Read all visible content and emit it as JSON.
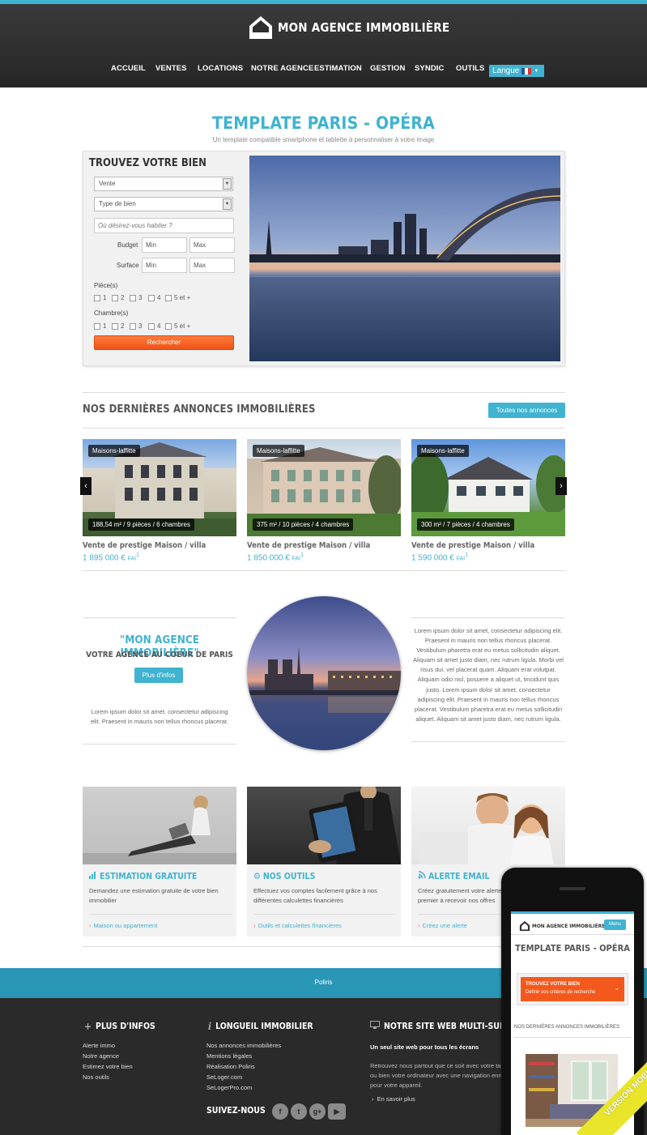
{
  "header": {
    "logo_text": "MON AGENCE IMMOBILIÈRE",
    "nav": [
      "ACCUEIL",
      "VENTES",
      "LOCATIONS",
      "NOTRE AGENCE",
      "ESTIMATION",
      "GESTION",
      "SYNDIC",
      "OUTILS"
    ],
    "language_label": "Langue",
    "language_icon": "french-flag-icon"
  },
  "hero": {
    "title": "TEMPLATE PARIS - OPÉRA",
    "subtitle": "Un template compatible smartphone et tablette à personnaliser à votre image"
  },
  "search": {
    "title": "TROUVEZ VOTRE BIEN",
    "transaction_value": "Vente",
    "type_placeholder": "Type de bien",
    "location_placeholder": "Où désirez-vous habiter ?",
    "budget_label": "Budget",
    "surface_label": "Surface",
    "min_placeholder": "Min",
    "max_placeholder": "Max",
    "rooms_label": "Pièce(s)",
    "bedrooms_label": "Chambre(s)",
    "count_options": [
      "1",
      "2",
      "3",
      "4",
      "5 et +"
    ],
    "submit_label": "Rechercher"
  },
  "listings": {
    "section_title": "NOS DERNIÈRES ANNONCES IMMOBILIÈRES",
    "all_button": "Toutes nos annonces",
    "items": [
      {
        "city": "Maisons-laffitte",
        "meta": "188,54 m² / 9 pièces / 6 chambres",
        "title": "Vente de prestige Maison / villa",
        "price": "1 895 000 €",
        "fai": "FAI",
        "note": "1"
      },
      {
        "city": "Maisons-laffitte",
        "meta": "375 m² / 10 pièces / 4 chambres",
        "title": "Vente de prestige Maison / villa",
        "price": "1 850 000 €",
        "fai": "FAI",
        "note": "1"
      },
      {
        "city": "Maisons-laffitte",
        "meta": "300 m² / 7 pièces / 4 chambres",
        "title": "Vente de prestige Maison / villa",
        "price": "1 590 000 €",
        "fai": "FAI",
        "note": "1"
      }
    ]
  },
  "about": {
    "title": "\"MON AGENCE IMMOBILIÈRE\"",
    "subtitle": "VOTRE AGENCE AU COEUR DE PARIS",
    "button": "Plus d'infos",
    "left_text": "Lorem ipsum dolor sit amet, consectetur adipiscing elit. Praesent in mauris non tellus rhoncus placerat.",
    "right_text": "Lorem ipsum dolor sit amet, consectetur adipiscing elit. Praesent in mauris non tellus rhoncus placerat. Vestibulum pharetra erat eu metus sollicitudin aliquet. Aliquam sit amet justo diam, nec rutrum ligula. Morbi vel risus dui, vel placerat quam. Aliquam erat volutpat. Aliquam odio nisl, posuere a aliquet ut, tincidunt quis justo. Lorem ipsum dolor sit amet, consectetur adipiscing elit. Praesent in mauris non tellus rhoncus placerat. Vestibulum pharetra erat eu metus sollicitudin aliquet. Aliquam sit amet justo diam, nec rutrum ligula."
  },
  "features": [
    {
      "icon": "bar-chart-icon",
      "title": "ESTIMATION GRATUITE",
      "text": "Demandez une estimation gratuite de votre bien immobilier",
      "link": "Maison ou appartement"
    },
    {
      "icon": "gear-icon",
      "title": "NOS OUTILS",
      "text": "Effectuez vos comptes facilement grâce à nos différentes calculettes financières",
      "link": "Outils et calculettes financières"
    },
    {
      "icon": "rss-icon",
      "title": "ALERTE EMAIL",
      "text": "Créez gratuitement votre alerte email et soyez le premier à recevoir nos offres",
      "link": "Créez une alerte"
    }
  ],
  "band": {
    "text": "Poliris"
  },
  "footer": {
    "col1": {
      "icon": "plus-icon",
      "title": "PLUS D'INFOS",
      "links": [
        "Alerte immo",
        "Notre agence",
        "Estimez votre bien",
        "Nos outils"
      ]
    },
    "col2": {
      "icon": "info-icon",
      "title": "LONGUEIL IMMOBILIER",
      "links": [
        "Nos annonces immobilières",
        "Mentions légales",
        "Réalisation Poliris",
        "SeLoger.com",
        "SeLogerPro.com"
      ],
      "follow": "SUIVEZ-NOUS",
      "social": [
        "f",
        "t",
        "g+",
        "▶"
      ]
    },
    "col3": {
      "icon": "monitor-icon",
      "title": "NOTRE SITE WEB MULTI-SUPPORTS",
      "bold": "Un seul site web pour tous les écrans",
      "text": "Retrouvez nous partout que ce soit avec votre tablette ou bien votre ordinateur avec une navigation enrichie pour votre appareil.",
      "link": "En savoir plus"
    }
  },
  "mobile": {
    "logo_text": "MON AGENCE IMMOBILIÈRE",
    "menu": "Menu",
    "title": "TEMPLATE PARIS - OPÉRA",
    "search_title": "TROUVEZ VOTRE BIEN",
    "search_sub": "Définir vos critères de recherche",
    "section": "NOS DERNIÈRES ANNONCES IMMOBILIÈRES",
    "ribbon": "VERSION MOBILE"
  },
  "colors": {
    "accent": "#3fb3d0",
    "orange": "#f3591c",
    "header": "#2e2e2e",
    "footer": "#2a2a2a"
  }
}
